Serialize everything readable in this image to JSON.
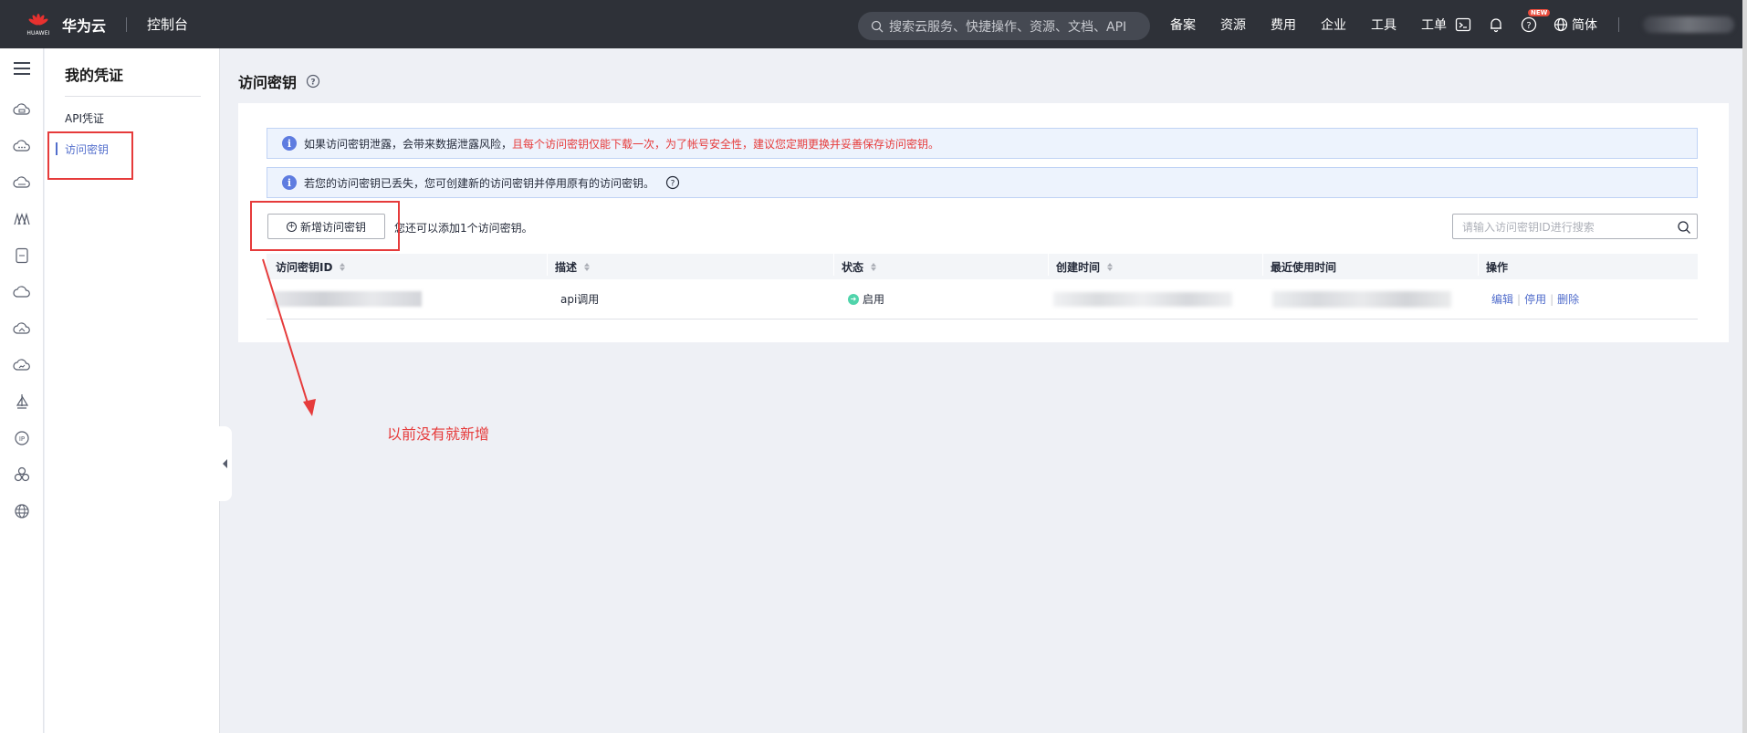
{
  "topbar": {
    "brand_short": "HUAWEI",
    "product": "华为云",
    "console": "控制台",
    "search_placeholder": "搜索云服务、快捷操作、资源、文档、API",
    "nav": [
      "备案",
      "资源",
      "费用",
      "企业",
      "工具",
      "工单"
    ],
    "new_badge": "NEW",
    "language": "简体"
  },
  "sidebar": {
    "title": "我的凭证",
    "items": [
      {
        "label": "API凭证",
        "active": false
      },
      {
        "label": "访问密钥",
        "active": true
      }
    ]
  },
  "main": {
    "page_title": "访问密钥",
    "alert1": {
      "normal": "如果访问密钥泄露，会带来数据泄露风险，",
      "warning": "且每个访问密钥仅能下载一次，为了帐号安全性，建议您定期更换并妥善保存访问密钥。"
    },
    "alert2": "若您的访问密钥已丢失，您可创建新的访问密钥并停用原有的访问密钥。",
    "add_button": "新增访问密钥",
    "remaining_text": "您还可以添加1个访问密钥。",
    "search_placeholder": "请输入访问密钥ID进行搜索",
    "table": {
      "columns": [
        "访问密钥ID",
        "描述",
        "状态",
        "创建时间",
        "最近使用时间",
        "操作"
      ],
      "rows": [
        {
          "description": "api调用",
          "status": "启用",
          "actions": [
            "编辑",
            "停用",
            "删除"
          ]
        }
      ]
    }
  },
  "annotation": {
    "text": "以前没有就新增"
  },
  "colors": {
    "topbar_bg": "#2e3138",
    "accent": "#526ecc",
    "annotation_red": "#e63b3b",
    "status_green": "#50d4ab"
  }
}
